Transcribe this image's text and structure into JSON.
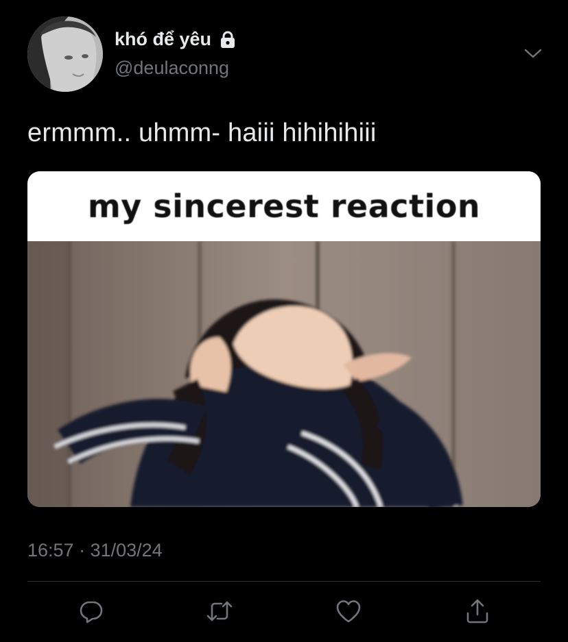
{
  "tweet": {
    "display_name": "khó để yêu",
    "handle": "@deulaconng",
    "text": "ermmm.. uhmm- haiii hihihihiii",
    "timestamp": "16:57 · 31/03/24",
    "media": {
      "caption": "my sincerest reaction"
    },
    "icons": {
      "avatar": "profile-photo",
      "protected": "lock-icon",
      "menu": "chevron-down-icon",
      "reply": "reply-icon",
      "retweet": "retweet-icon",
      "like": "heart-icon",
      "share": "share-icon"
    }
  },
  "colors": {
    "background": "#000000",
    "primary_text": "#e7e9ea",
    "secondary_text": "#71767b",
    "divider": "#2f3336"
  }
}
